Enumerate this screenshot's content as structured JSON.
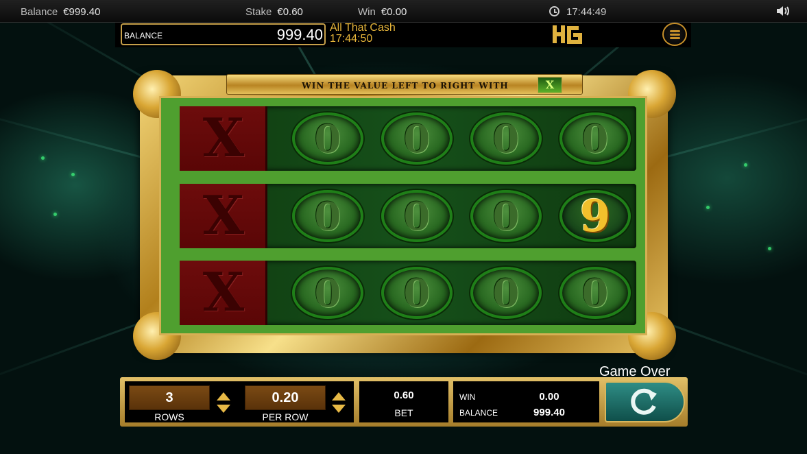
{
  "status_bar": {
    "balance_label": "Balance",
    "balance_value": "€999.40",
    "stake_label": "Stake",
    "stake_value": "€0.60",
    "win_label": "Win",
    "win_value": "€0.00",
    "time": "17:44:49",
    "icons": [
      "clock-icon",
      "speaker-icon"
    ]
  },
  "header": {
    "balance_label": "BALANCE",
    "balance_value": "999.40",
    "game_name": "All That Cash",
    "game_time": "17:44:50",
    "icons": [
      "hg-logo",
      "menu-icon"
    ]
  },
  "banner": {
    "text": "WIN THE VALUE LEFT TO RIGHT WITH",
    "symbol": "X"
  },
  "grid": {
    "rows": [
      {
        "x_symbol": "X",
        "symbols": [
          "0",
          "0",
          "0",
          "0"
        ]
      },
      {
        "x_symbol": "X",
        "symbols": [
          "0",
          "0",
          "0",
          "9"
        ]
      },
      {
        "x_symbol": "X",
        "symbols": [
          "0",
          "0",
          "0",
          "0"
        ]
      }
    ]
  },
  "controls": {
    "status_text": "Game Over",
    "rows_value": "3",
    "rows_label": "ROWS",
    "per_row_value": "0.20",
    "per_row_label": "PER ROW",
    "bet_value": "0.60",
    "bet_label": "BET",
    "win_label": "WIN",
    "win_value": "0.00",
    "balance_label": "BALANCE",
    "balance_value": "999.40",
    "icons": [
      "arrow-up-icon",
      "arrow-down-icon",
      "replay-icon"
    ]
  },
  "colors": {
    "gold": "#e6b53a",
    "frame_green": "#4f9f2f",
    "x_red": "#6d0c0c",
    "spin_teal": "#2f8d85"
  }
}
